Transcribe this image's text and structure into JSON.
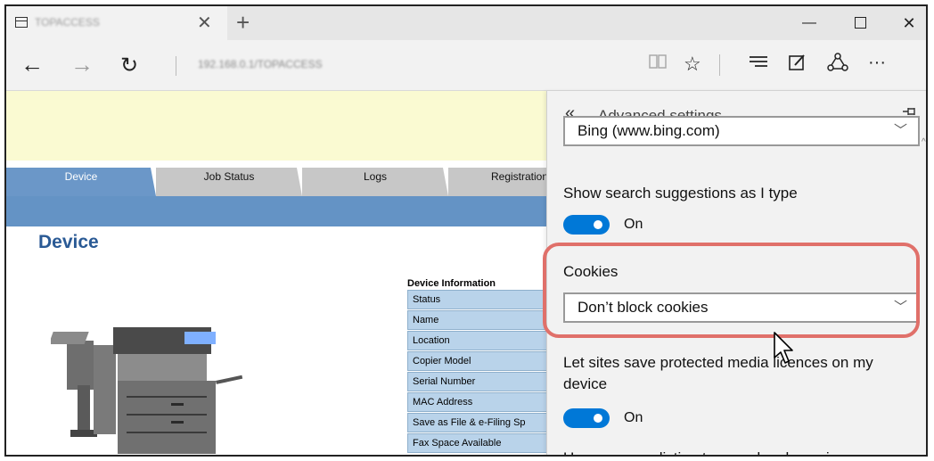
{
  "browser": {
    "tab_title": "TOPACCESS",
    "url": "192.168.0.1/TOPACCESS",
    "icons": [
      "tab-page-icon",
      "close-icon",
      "plus-icon",
      "minimize-icon",
      "maximize-icon",
      "close-window-icon",
      "back-arrow-icon",
      "forward-arrow-icon",
      "refresh-icon",
      "reading-view-icon",
      "favorite-star-icon",
      "hub-icon",
      "web-note-icon",
      "share-icon",
      "more-icon"
    ]
  },
  "page": {
    "tabs": [
      {
        "label": "Device",
        "active": true
      },
      {
        "label": "Job Status",
        "active": false
      },
      {
        "label": "Logs",
        "active": false
      },
      {
        "label": "Registration",
        "active": false
      }
    ],
    "heading": "Device",
    "device_info_title": "Device Information",
    "device_info_rows": [
      "Status",
      "Name",
      "Location",
      "Copier Model",
      "Serial Number",
      "MAC Address",
      "Save as File & e-Filing Sp",
      "Fax Space Available"
    ]
  },
  "settings_pane": {
    "title": "Advanced settings",
    "search_provider_value": "Bing (www.bing.com)",
    "search_suggestions_label": "Show search suggestions as I type",
    "search_suggestions_state": "On",
    "cookies_label": "Cookies",
    "cookies_value": "Don’t block cookies",
    "media_licenses_label": "Let sites save protected media licences on my device",
    "media_licenses_state": "On",
    "next_setting_partial": "Use page prediction to speed up browsing"
  },
  "colors": {
    "highlight": "#e0706a",
    "toggle_on": "#0078d7",
    "page_tab_active": "#6b97c8",
    "page_band": "#6493c5",
    "page_heading": "#2a5a95",
    "yellow_band": "#fafad2",
    "info_cell": "#b9d3ea"
  }
}
